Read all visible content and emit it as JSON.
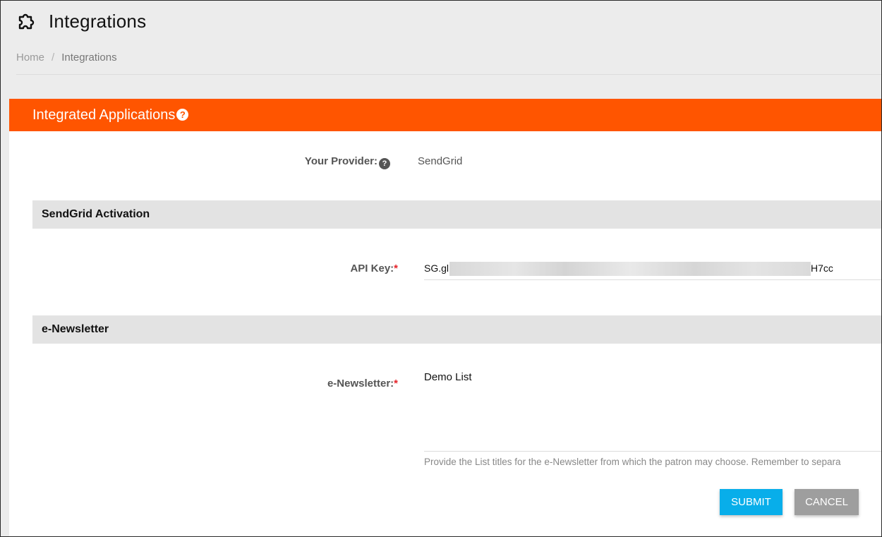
{
  "header": {
    "title": "Integrations",
    "icon": "puzzle-icon"
  },
  "breadcrumb": {
    "home": "Home",
    "separator": "/",
    "current": "Integrations"
  },
  "panel": {
    "title": "Integrated Applications",
    "help_glyph": "?",
    "accent": "#ff5500"
  },
  "provider": {
    "label": "Your Provider:",
    "help_glyph": "?",
    "value": "SendGrid"
  },
  "sections": {
    "activation": "SendGrid Activation",
    "newsletter": "e-Newsletter"
  },
  "api_key": {
    "label": "API Key:",
    "required": "*",
    "prefix": "SG.gl",
    "suffix": "H7cc"
  },
  "newsletter_field": {
    "label": "e-Newsletter:",
    "required": "*",
    "value": "Demo List",
    "hint": "Provide the List titles for the e-Newsletter from which the patron may choose. Remember to separa"
  },
  "buttons": {
    "submit": "SUBMIT",
    "cancel": "CANCEL",
    "submit_color": "#08aeea",
    "cancel_color": "#9e9e9e"
  }
}
